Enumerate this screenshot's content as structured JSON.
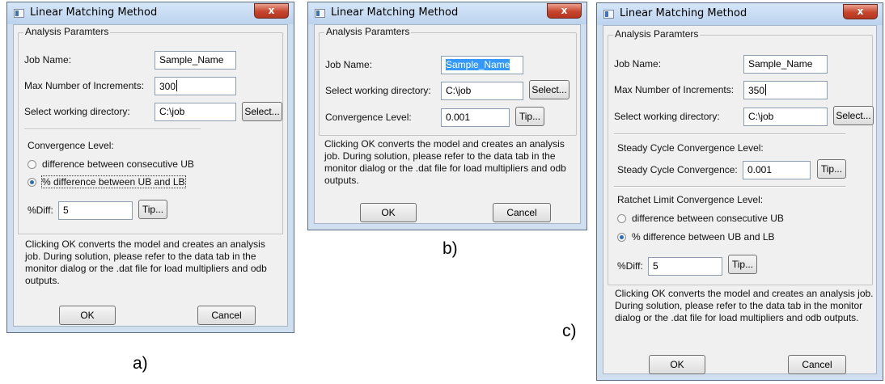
{
  "app_title": "Linear Matching Method",
  "close_glyph": "x",
  "group_legend": "Analysis Paramters",
  "labels": {
    "job_name": "Job Name:",
    "max_increments": "Max Number of Increments:",
    "working_directory": "Select working directory:",
    "convergence_level": "Convergence Level:",
    "diff_consecutive": "difference between consecutive UB",
    "diff_ub_lb": "% difference between UB and LB",
    "pct_diff": "%Diff:",
    "steady_section": "Steady Cycle Convergence Level:",
    "steady_conv": "Steady Cycle Convergence:",
    "ratchet_section": "Ratchet Limit Convergence Level:"
  },
  "buttons": {
    "select": "Select...",
    "tip": "Tip...",
    "ok": "OK",
    "cancel": "Cancel"
  },
  "info_text": "Clicking OK converts the model and creates an analysis job. During solution, please refer to the data tab in the monitor dialog or the .dat file for load multipliers and odb outputs.",
  "figure_labels": {
    "a": "a)",
    "b": "b)",
    "c": "c)"
  },
  "dialog_a": {
    "job_name": "Sample_Name",
    "max_increments": "300",
    "working_directory": "C:\\job",
    "selected_option": "% difference between UB and LB",
    "pct_diff": "5"
  },
  "dialog_b": {
    "job_name": "Sample_Name",
    "working_directory": "C:\\job",
    "convergence_level": "0.001"
  },
  "dialog_c": {
    "job_name": "Sample_Name",
    "max_increments": "350",
    "working_directory": "C:\\job",
    "steady_conv": "0.001",
    "selected_option": "% difference between UB and LB",
    "pct_diff": "5"
  }
}
